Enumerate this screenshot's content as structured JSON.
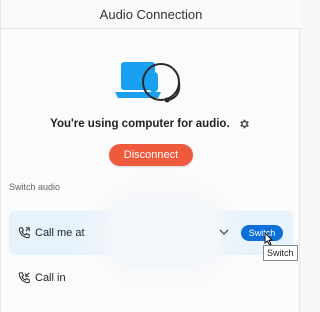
{
  "window": {
    "title": "Audio Connection"
  },
  "hero": {
    "icon": "computer-audio-icon",
    "status_text": "You're using computer for audio.",
    "settings_icon": "gear-icon"
  },
  "actions": {
    "disconnect_label": "Disconnect",
    "disconnect_color": "#f05a3c"
  },
  "switch_audio": {
    "section_label": "Switch audio",
    "options": [
      {
        "label": "Call me at",
        "icon": "phone-outgoing-icon",
        "dropdown_icon": "chevron-down-icon",
        "button_label": "Switch",
        "button_color": "#0b6fd8",
        "highlighted_bg": "#e7f3fc"
      },
      {
        "label": "Call in",
        "icon": "phone-incoming-icon"
      }
    ],
    "tooltip": "Switch"
  }
}
